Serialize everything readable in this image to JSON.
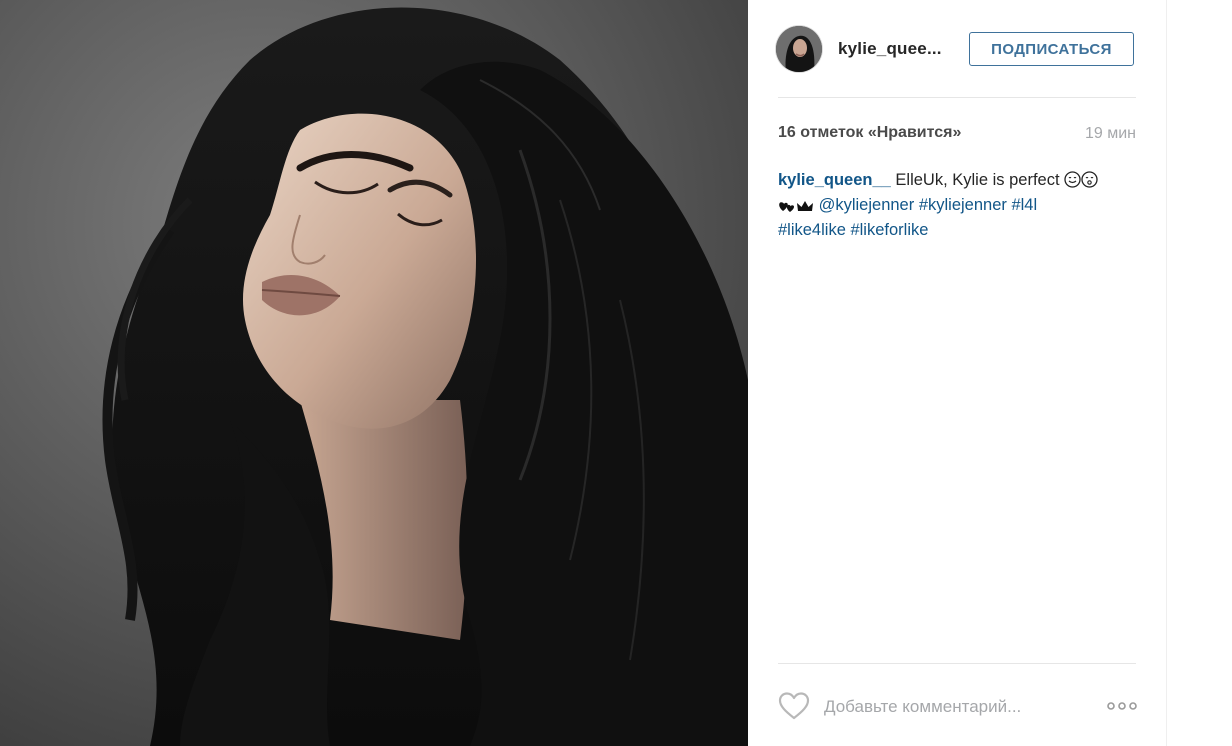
{
  "post": {
    "image_alt": "Portrait of a woman with long dark hair, eyes closed",
    "author": {
      "username": "kylie_quee...",
      "follow_label": "ПОДПИСАТЬСЯ"
    },
    "likes_text": "16 отметок «Нравится»",
    "time_ago": "19 мин",
    "caption": {
      "username": "kylie_queen__",
      "text_1": " ElleUk, Kylie is perfect ",
      "mention": "@kyliejenner",
      "hashtags": [
        "#kyliejenner",
        "#l4l",
        "#like4like",
        "#likeforlike"
      ]
    },
    "comment_placeholder": "Добавьте комментарий...",
    "icons": {
      "like": "heart-outline-icon",
      "more": "more-options-icon"
    },
    "colors": {
      "link": "#125688",
      "button": "#3f729b",
      "muted": "#a5a7aa"
    }
  }
}
